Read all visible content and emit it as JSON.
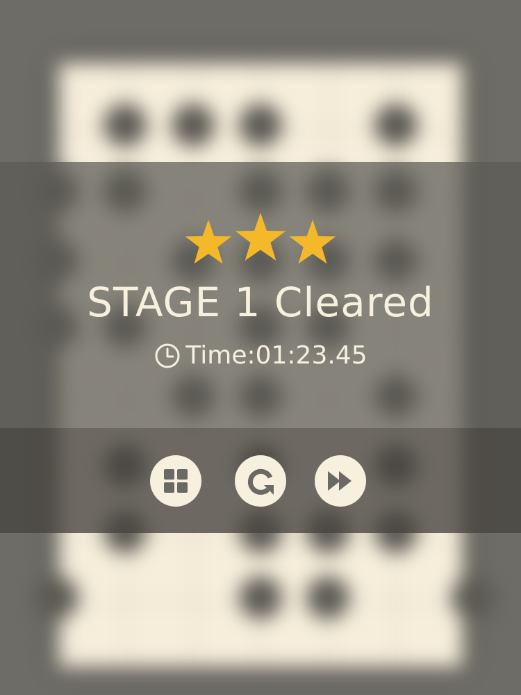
{
  "result": {
    "stars_earned": 3,
    "stars_total": 3,
    "title": "STAGE 1 Cleared",
    "time_label": "Time:",
    "time_value": "01:23.45"
  },
  "icons": {
    "clock": "clock-icon",
    "menu": "grid-menu-icon",
    "retry": "retry-icon",
    "next": "fast-forward-icon"
  },
  "colors": {
    "star": "#f4b92a",
    "text": "#f7f0df",
    "button": "#f7f0df",
    "icon": "#6b6963",
    "board": "#f6eedb",
    "piece": "#5b5953"
  }
}
